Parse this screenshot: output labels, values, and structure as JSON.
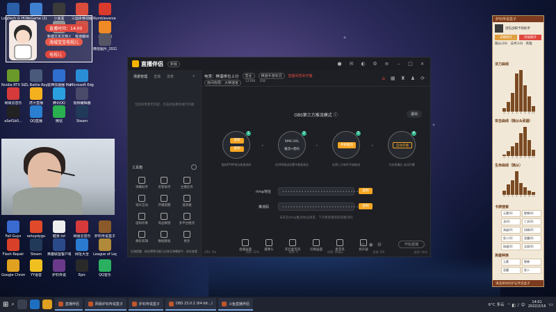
{
  "overlay": {
    "live_time": "直播时间：14:00",
    "line1": "海城宝宝电视儿",
    "line2": "电视儿"
  },
  "desktop_icons": [
    {
      "label": "Logitech G HUB",
      "color": "#2b5fa8"
    },
    {
      "label": "WeGame (2)",
      "color": "#3f7fcf"
    },
    {
      "label": "小黑盒",
      "color": "#3a3a3a"
    },
    {
      "label": "三国杀移动版",
      "color": "#d94c3b"
    },
    {
      "label": "Rumbleverse Party",
      "color": "#d93a2b"
    },
    {
      "label": "有道翻译",
      "color": "#c63d2f"
    },
    {
      "label": "斗鱼直播",
      "color": "#f08a24"
    },
    {
      "label": "新建文本文档.txt",
      "color": "#888"
    },
    {
      "label": "微信图片_2022021...",
      "color": "#556"
    },
    {
      "label": "Nvidia RTX Studio",
      "color": "#6a9a2a"
    },
    {
      "label": "ZL Battle Royale",
      "color": "#4a5a7a"
    },
    {
      "label": "雷神加速器 Mahjong",
      "color": "#2f6fcf"
    },
    {
      "label": "Microsoft Edge",
      "color": "#2a8ed6"
    },
    {
      "label": "网易云音乐",
      "color": "#d63a3a"
    },
    {
      "label": "虎牙直播",
      "color": "#f5b01d"
    },
    {
      "label": "腾讯QQ",
      "color": "#2aa0e0"
    },
    {
      "label": "视频编辑器",
      "color": "#4a4a6a"
    },
    {
      "label": "aSef1b0...",
      "color": "#222"
    },
    {
      "label": "QQ直播",
      "color": "#2a7fd0"
    },
    {
      "label": "微信",
      "color": "#2ab050"
    },
    {
      "label": "Steam",
      "color": "#223a5a"
    },
    {
      "label": "Edge",
      "color": "#2a8ed6"
    },
    {
      "label": "网易云音乐",
      "color": "#d63a3a"
    },
    {
      "label": "炉石传说盒子",
      "color": "#8a5a2a"
    },
    {
      "label": "Fall Guys",
      "color": "#3a6ad0"
    },
    {
      "label": "setupdygu",
      "color": "#e04a2a"
    },
    {
      "label": "健身.txt",
      "color": "#eee"
    },
    {
      "label": "网易云音乐",
      "color": "#d63a3a"
    },
    {
      "label": "炉石传说盒子",
      "color": "#8a5a2a"
    },
    {
      "label": "Flash Repair",
      "color": "#d8402a"
    },
    {
      "label": "Steam",
      "color": "#223a5a"
    },
    {
      "label": "英雄联盟客户端",
      "color": "#2a4a8a"
    },
    {
      "label": "网址大全",
      "color": "#2a7ad0"
    },
    {
      "label": "League of Legends",
      "color": "#b08a3a"
    },
    {
      "label": "Google Chrome",
      "color": "#e0a020"
    },
    {
      "label": "YY语音",
      "color": "#f0c020"
    },
    {
      "label": "炉石传说",
      "color": "#6a3a8a"
    },
    {
      "label": "Epic",
      "color": "#2a2a2a"
    },
    {
      "label": "QQ音乐",
      "color": "#2ab060"
    }
  ],
  "app": {
    "logo": "直播伴侣",
    "version": "新版",
    "room_label": "电竞：棋谐排位上分",
    "tag1": "营业",
    "tag2": "棋谐手游实况",
    "live_status": "直播间暂未开播",
    "sub_label1": "房间权限：大棋谐官",
    "room_no": "12306",
    "fans": "358",
    "tabs": [
      "场景管理",
      "直播",
      "连麦"
    ],
    "add_scene_hint": "当前场景暂无内容，点击添加素材进行开播",
    "tools_title": "工具箱",
    "tools": [
      [
        "弹幕助手",
        "房管助手",
        "主播任务"
      ],
      [
        "观众互动",
        "开播提醒",
        "道具箱"
      ],
      [
        "虚拟形象",
        "商品橱窗",
        "多平台推流"
      ],
      [
        "精彩剪辑",
        "数据看板",
        "更多"
      ]
    ],
    "obs_mode": "OBS第三方推流模式",
    "exit": "退出",
    "steps": [
      {
        "n": "1",
        "label": "复制RTMP地址和推流码",
        "btn1": "复制",
        "btn2": "复制"
      },
      {
        "n": "2",
        "label": "在OBS推流设置中粘贴地址",
        "mid": "RMS URL",
        "mid2": "推流+密码"
      },
      {
        "n": "3",
        "label": "在第三方软件开始推流",
        "btn": "开始推流"
      },
      {
        "n": "4",
        "label": "开启直播后 自动开播",
        "btn": "自动开播"
      }
    ],
    "rtmp_label": "rtmp地址",
    "rtmp_value": "••••••••••••••••••••••••••••",
    "rtmp_copy": "复制",
    "key_label": "推流码",
    "key_value": "••••••••••••••••••••••••••••••",
    "key_copy": "复制",
    "notice": "未开启rtmp推流地址请求，下次更新重新获取推流码",
    "bottom_tools": [
      "直播画面",
      "摄像头",
      "开启麦克风",
      "切换画面",
      "麦克风",
      "扬声器"
    ],
    "go_live": "开始直播",
    "status": "礼物提醒、粉丝牌等功能已迁移至弹幕助手，前往查看",
    "stats": [
      "CPU: 5%",
      "内存: 52%",
      "帧率: 0",
      "码率: 0kbps",
      "丢帧: 0%",
      "延迟: 0ms"
    ]
  },
  "hs_box": {
    "title": "炉石传说盒子",
    "sub": "酒馆战棋卡组助手",
    "btn1": "天梯统计",
    "btn2": "对局统计",
    "row1": [
      "随从(20)",
      "法术(10)",
      "英雄"
    ],
    "sec1": "法力曲线",
    "sec2": "攻击曲线（随从&武器）",
    "sec3": "生命曲线（随从）",
    "mana_bars": [
      2,
      5,
      10,
      20,
      22,
      14,
      8,
      3
    ],
    "atk_bars": [
      1,
      3,
      6,
      8,
      14,
      18,
      10,
      4
    ],
    "hp_bars": [
      3,
      7,
      10,
      16,
      8,
      5,
      3,
      2
    ],
    "axis": [
      "0",
      "1",
      "2",
      "3",
      "4",
      "5",
      "6",
      "7+"
    ],
    "sec4": "卡牌搜索",
    "cards": [
      "元素(0)",
      "野兽(0)",
      "龙(0)",
      "亡灵(0)",
      "海盗(0)",
      "机械(0)",
      "鱼人(0)",
      "恶魔(0)",
      "纳迦(0)",
      "全部(0)"
    ],
    "sec5": "英雄种族",
    "races": [
      "元素",
      "野兽",
      "恶魔",
      "鱼人"
    ],
    "footer": "请选择你的炉石传说盒子"
  },
  "taskbar": {
    "apps": [
      {
        "label": "直播伴侣"
      },
      {
        "label": "网易炉石传说盒子"
      },
      {
        "label": "炉石传说盒子"
      },
      {
        "label": "OBS 23.0.2 (64-bit...)"
      },
      {
        "label": "斗鱼直播伴侣"
      }
    ],
    "weather": "6°C 多云",
    "time": "14:01",
    "date": "2022/2/16"
  },
  "colors": {
    "accent": "#f5a623",
    "green": "#30b58a",
    "red": "#e0483e"
  }
}
